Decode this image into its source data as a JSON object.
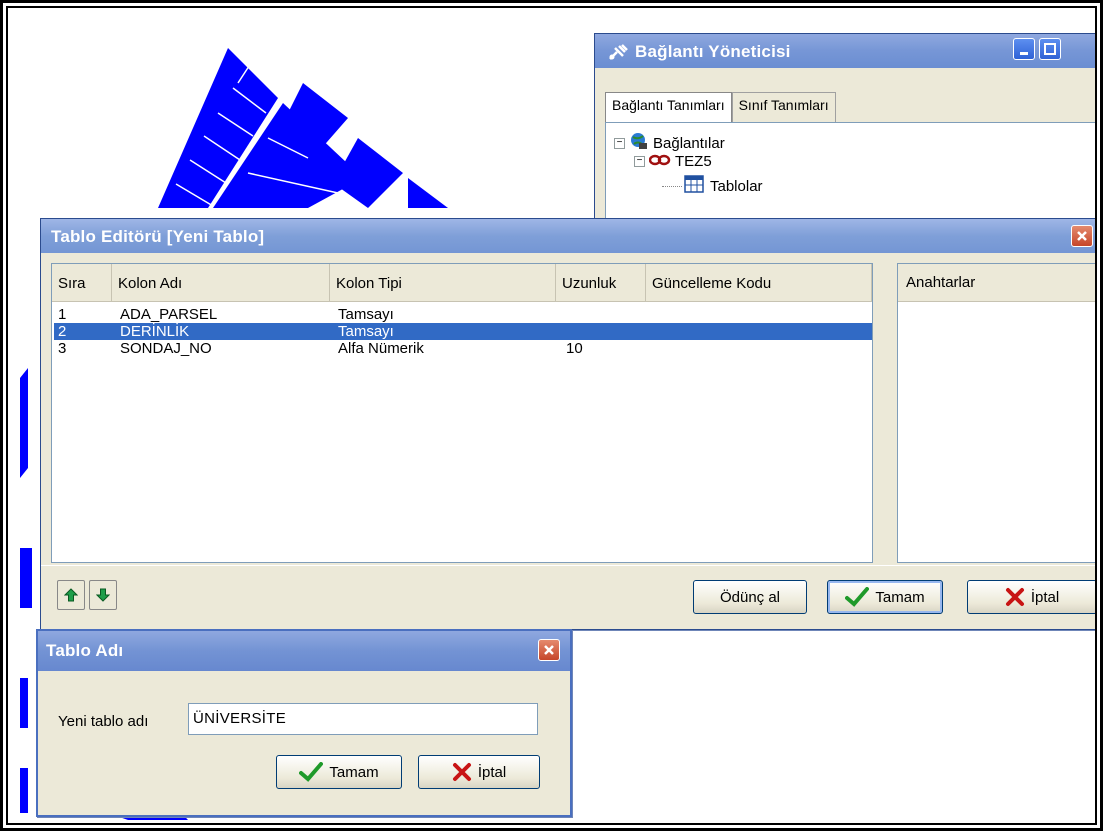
{
  "colors": {
    "map_fill": "#0000ff",
    "title_bar": "#7f9fd8",
    "selection": "#316ac5",
    "window_bg": "#ece9d8"
  },
  "connection_manager": {
    "title": "Bağlantı Yöneticisi",
    "title_icon": "connection-plug-icon",
    "tabs": [
      "Bağlantı Tanımları",
      "Sınıf Tanımları"
    ],
    "tree": {
      "root": "Bağlantılar",
      "connection": "TEZ5",
      "child": "Tablolar"
    }
  },
  "table_editor": {
    "title": "Tablo Editörü [Yeni Tablo]",
    "columns": [
      "Sıra",
      "Kolon Adı",
      "Kolon Tipi",
      "Uzunluk",
      "Güncelleme Kodu"
    ],
    "rows": [
      {
        "sira": "1",
        "kolon_adi": "ADA_PARSEL",
        "kolon_tipi": "Tamsayı",
        "uzunluk": "",
        "guncelleme_kodu": ""
      },
      {
        "sira": "2",
        "kolon_adi": "DERİNLİK",
        "kolon_tipi": "Tamsayı",
        "uzunluk": "",
        "guncelleme_kodu": ""
      },
      {
        "sira": "3",
        "kolon_adi": "SONDAJ_NO",
        "kolon_tipi": "Alfa Nümerik",
        "uzunluk": "10",
        "guncelleme_kodu": ""
      }
    ],
    "selected_row": 2,
    "keys_header": "Anahtarlar",
    "buttons": {
      "borrow": "Ödünç al",
      "ok": "Tamam",
      "cancel": "İptal"
    }
  },
  "table_name_dialog": {
    "title": "Tablo Adı",
    "label": "Yeni tablo adı",
    "value": "ÜNİVERSİTE",
    "buttons": {
      "ok": "Tamam",
      "cancel": "İptal"
    }
  }
}
